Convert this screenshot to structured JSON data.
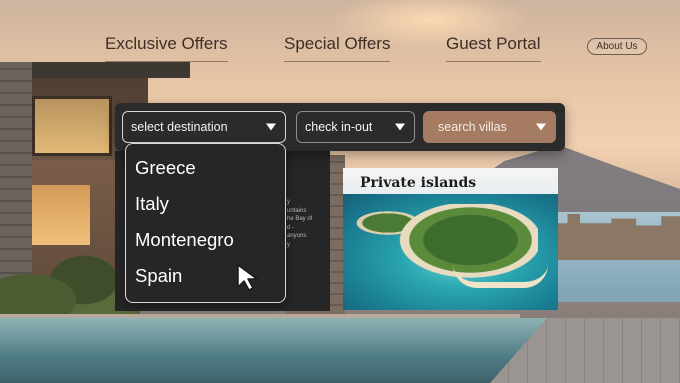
{
  "nav": {
    "exclusive_offers": "Exclusive Offers",
    "special_offers": "Special Offers",
    "guest_portal": "Guest Portal",
    "about_us": "About Us"
  },
  "search": {
    "destination_placeholder": "select destination",
    "check_in_out": "check in-out",
    "search_villas": "search villas",
    "destination_options": [
      "Greece",
      "Italy",
      "Montenegro",
      "Spain"
    ]
  },
  "info_text": "y\nuntains\nhe Bay of\nd -\nanyons\ny",
  "featured": {
    "title": "Private islands"
  },
  "colors": {
    "bar_bg": "#2b2b2b",
    "accent_button": "#a57c62",
    "dropdown_bg": "#262626"
  },
  "icons": {
    "dropdown_chevron": "chevron-down-icon",
    "pointer": "mouse-cursor-icon"
  }
}
